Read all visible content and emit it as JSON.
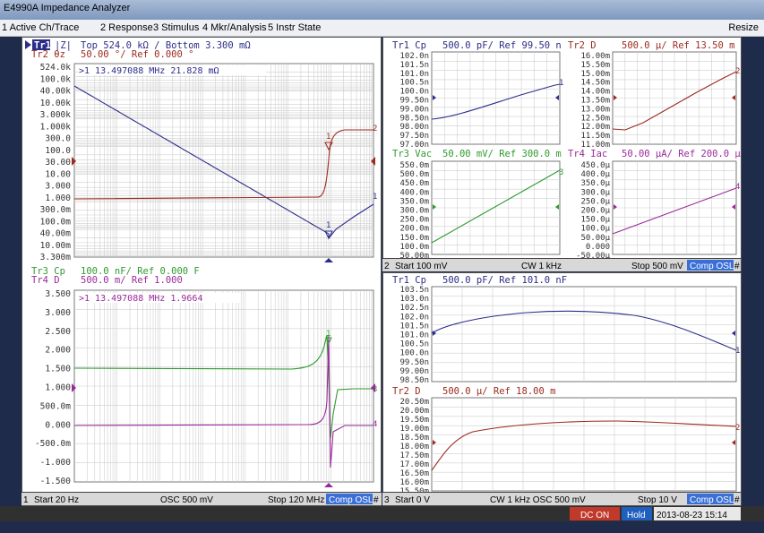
{
  "app": {
    "title": "E4990A Impedance Analyzer"
  },
  "menu": {
    "items": [
      "1 Active Ch/Trace",
      "2 Response",
      "3 Stimulus",
      "4 Mkr/Analysis",
      "5 Instr State"
    ],
    "resize": "Resize"
  },
  "colors": {
    "blue": "#2b2d8a",
    "red": "#9b2a1e",
    "green": "#2e9a2e",
    "purple": "#9a2a9a",
    "grid": "#c8c8c8",
    "scale": "#7a1c1c"
  },
  "ch1": {
    "tr1_label": "Tr1",
    "tr1_fmt": "|Z|",
    "tr1_scale": "Top 524.0 kΩ / Bottom 3.300 mΩ",
    "tr2_label": "Tr2 θz",
    "tr2_scale": "50.00 °/ Ref 0.000 °",
    "marker_readout": ">1 13.497088 MHz  21.828 mΩ",
    "y_ticks": [
      "524.0k",
      "100.0k",
      "40.00k",
      "10.00k",
      "3.000k",
      "1.000k",
      "300.0",
      "100.0",
      "30.00",
      "10.00",
      "3.000",
      "1.000",
      "300.0m",
      "100.0m",
      "40.00m",
      "10.00m",
      "3.300m"
    ],
    "tr3_header": "Tr3 Cp",
    "tr3_scale": "100.0 nF/ Ref 0.000 F",
    "tr4_header": "Tr4 D",
    "tr4_scale": "500.0 m/ Ref 1.000",
    "marker2_readout": ">1 13.497088 MHz  1.9664",
    "y2_ticks": [
      "3.500",
      "3.000",
      "2.500",
      "2.000",
      "1.500",
      "1.000",
      "500.0m",
      "0.000",
      "-500.0m",
      "-1.000",
      "-1.500"
    ],
    "strip": {
      "num": "1",
      "start": "Start 20 Hz",
      "osc": "OSC 500 mV",
      "stop": "Stop 120 MHz",
      "cal": "Comp OSL",
      "hash": "#"
    }
  },
  "ch2": {
    "tr1": {
      "title": "Tr1 Cp",
      "scale": "500.0 pF/ Ref 99.50 n",
      "ticks": [
        "102.0n",
        "101.5n",
        "101.0n",
        "100.5n",
        "100.0n",
        "99.50n",
        "99.00n",
        "98.50n",
        "98.00n",
        "97.50n",
        "97.00n"
      ]
    },
    "tr2": {
      "title": "Tr2 D",
      "scale": "500.0 µ/ Ref 13.50 m",
      "ticks": [
        "16.00m",
        "15.50m",
        "15.00m",
        "14.50m",
        "14.00m",
        "13.50m",
        "13.00m",
        "12.50m",
        "12.00m",
        "11.50m",
        "11.00m"
      ]
    },
    "tr3": {
      "title": "Tr3 Vac",
      "scale": "50.00 mV/ Ref 300.0 m",
      "ticks": [
        "550.0m",
        "500.0m",
        "450.0m",
        "400.0m",
        "350.0m",
        "300.0m",
        "250.0m",
        "200.0m",
        "150.0m",
        "100.0m",
        "50.00m"
      ]
    },
    "tr4": {
      "title": "Tr4 Iac",
      "scale": "50.00 µA/ Ref 200.0 µ",
      "ticks": [
        "450.0µ",
        "400.0µ",
        "350.0µ",
        "300.0µ",
        "250.0µ",
        "200.0µ",
        "150.0µ",
        "100.0µ",
        "50.00µ",
        "0.000",
        "-50.00µ"
      ]
    },
    "strip": {
      "num": "2",
      "start": "Start 100 mV",
      "cw": "CW 1 kHz",
      "stop": "Stop 500 mV",
      "cal": "Comp OSL",
      "hash": "#"
    }
  },
  "ch3": {
    "tr1": {
      "title": "Tr1 Cp",
      "scale": "500.0 pF/ Ref 101.0 nF",
      "ticks": [
        "103.5n",
        "103.0n",
        "102.5n",
        "102.0n",
        "101.5n",
        "101.0n",
        "100.5n",
        "100.0n",
        "99.50n",
        "99.00n",
        "98.50n"
      ]
    },
    "tr2": {
      "title": "Tr2 D",
      "scale": "500.0 µ/ Ref 18.00 m",
      "ticks": [
        "20.50m",
        "20.00m",
        "19.50m",
        "19.00m",
        "18.50m",
        "18.00m",
        "17.50m",
        "17.00m",
        "16.50m",
        "16.00m",
        "15.50m"
      ]
    },
    "strip": {
      "num": "3",
      "start": "Start 0 V",
      "cw": "CW 1 kHz  OSC 500 mV",
      "stop": "Stop 10 V",
      "cal": "Comp OSL",
      "hash": "#"
    }
  },
  "status": {
    "dc": "DC ON",
    "hold": "Hold",
    "datetime": "2013-08-23 15:14"
  },
  "trace_numbers": [
    "1",
    "2",
    "3",
    "4"
  ]
}
